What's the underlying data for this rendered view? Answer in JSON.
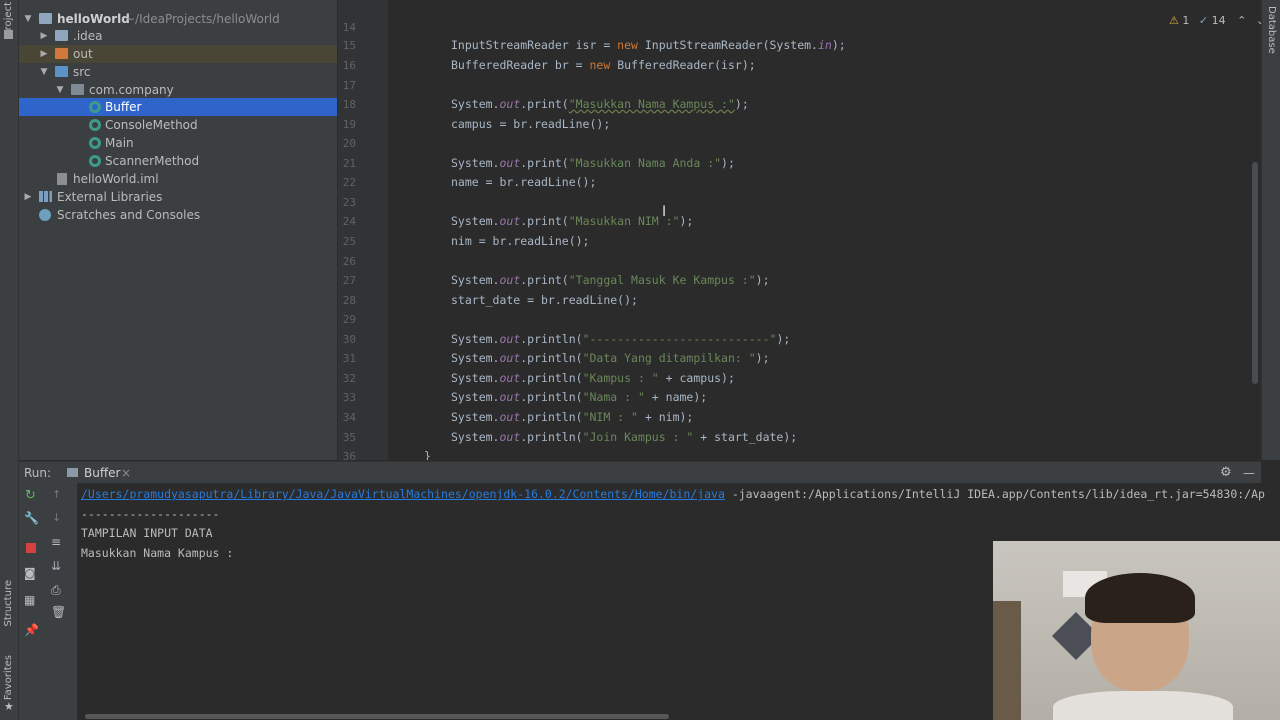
{
  "left_strip": {
    "project_label": "Project",
    "structure_label": "Structure",
    "favorites_label": "Favorites"
  },
  "right_strip": {
    "database_label": "Database"
  },
  "project_tree": {
    "root_name": "helloWorld",
    "root_path": "~/IdeaProjects/helloWorld",
    "items": [
      {
        "label": "helloWorld",
        "path": "~/IdeaProjects/helloWorld"
      },
      {
        "label": ".idea"
      },
      {
        "label": "out"
      },
      {
        "label": "src"
      },
      {
        "label": "com.company"
      },
      {
        "label": "Buffer"
      },
      {
        "label": "ConsoleMethod"
      },
      {
        "label": "Main"
      },
      {
        "label": "ScannerMethod"
      },
      {
        "label": "helloWorld.iml"
      },
      {
        "label": "External Libraries"
      },
      {
        "label": "Scratches and Consoles"
      }
    ]
  },
  "editor": {
    "inspection_warnings": "1",
    "inspection_typos": "14",
    "line_numbers": [
      "14",
      "15",
      "16",
      "17",
      "18",
      "19",
      "20",
      "21",
      "22",
      "23",
      "24",
      "25",
      "26",
      "27",
      "28",
      "29",
      "30",
      "31",
      "32",
      "33",
      "34",
      "35",
      "36"
    ],
    "lines": {
      "l15_a": "InputStreamReader isr = ",
      "l15_kw": "new",
      "l15_b": " InputStreamReader(System.",
      "l15_fld": "in",
      "l15_c": ");",
      "l16_a": "BufferedReader br = ",
      "l16_kw": "new",
      "l16_b": " BufferedReader(isr);",
      "l18_a": "System.",
      "l18_fld": "out",
      "l18_b": ".print(",
      "l18_str": "\"Masukkan Nama Kampus :\"",
      "l18_c": ");",
      "l19": "campus = br.readLine();",
      "l21_a": "System.",
      "l21_fld": "out",
      "l21_b": ".print(",
      "l21_str": "\"Masukkan Nama Anda :\"",
      "l21_c": ");",
      "l22": "name = br.readLine();",
      "l24_a": "System.",
      "l24_fld": "out",
      "l24_b": ".print(",
      "l24_str": "\"Masukkan NIM :\"",
      "l24_c": ");",
      "l25": "nim = br.readLine();",
      "l27_a": "System.",
      "l27_fld": "out",
      "l27_b": ".print(",
      "l27_str": "\"Tanggal Masuk Ke Kampus :\"",
      "l27_c": ");",
      "l28": "start_date = br.readLine();",
      "l30_a": "System.",
      "l30_fld": "out",
      "l30_b": ".println(",
      "l30_str": "\"--------------------------\"",
      "l30_c": ");",
      "l31_a": "System.",
      "l31_fld": "out",
      "l31_b": ".println(",
      "l31_str": "\"Data Yang ditampilkan: \"",
      "l31_c": ");",
      "l32_a": "System.",
      "l32_fld": "out",
      "l32_b": ".println(",
      "l32_str": "\"Kampus : \"",
      "l32_c": " + campus);",
      "l33_a": "System.",
      "l33_fld": "out",
      "l33_b": ".println(",
      "l33_str": "\"Nama : \"",
      "l33_c": " + name);",
      "l34_a": "System.",
      "l34_fld": "out",
      "l34_b": ".println(",
      "l34_str": "\"NIM : \"",
      "l34_c": " + nim);",
      "l35_a": "System.",
      "l35_fld": "out",
      "l35_b": ".println(",
      "l35_str": "\"Join Kampus : \"",
      "l35_c": " + start_date);",
      "l36": "}"
    }
  },
  "run_panel": {
    "run_label": "Run:",
    "tab_label": "Buffer",
    "console": {
      "cmd_link": "/Users/pramudyasaputra/Library/Java/JavaVirtualMachines/openjdk-16.0.2/Contents/Home/bin/java",
      "cmd_rest": " -javaagent:/Applications/IntelliJ IDEA.app/Contents/lib/idea_rt.jar=54830:/Ap",
      "line2": "--------------------",
      "line3": "TAMPILAN INPUT DATA",
      "line4": "Masukkan Nama Kampus :"
    }
  },
  "colors": {
    "selection": "#2f65ca",
    "keyword": "#cc7832",
    "string": "#6a8759",
    "field": "#9876aa",
    "link": "#287bde"
  }
}
